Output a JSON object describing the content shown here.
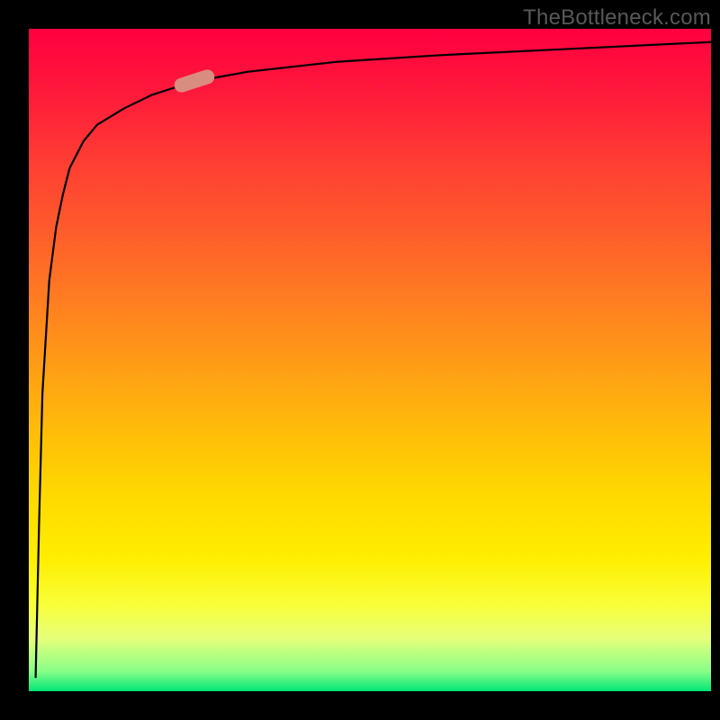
{
  "attribution": "TheBottleneck.com",
  "colors": {
    "frame": "#000000",
    "gradient_top": "#ff0040",
    "gradient_mid": "#ffd800",
    "gradient_bottom": "#00e676",
    "curve": "#000000",
    "marker": "#d98c80",
    "attribution_text": "#585858"
  },
  "chart_data": {
    "type": "line",
    "title": "",
    "xlabel": "",
    "ylabel": "",
    "xlim": [
      0,
      100
    ],
    "ylim": [
      0,
      100
    ],
    "series": [
      {
        "name": "curve",
        "x": [
          1.0,
          1.5,
          2,
          3,
          4,
          5,
          6,
          8,
          10,
          14,
          18,
          24,
          32,
          45,
          60,
          80,
          100
        ],
        "values": [
          2,
          25,
          45,
          62,
          70,
          75,
          79,
          83,
          85.5,
          88,
          90,
          92,
          93.5,
          95,
          96,
          97,
          98
        ]
      }
    ],
    "marker": {
      "x": 24,
      "y": 91
    },
    "legend": [],
    "grid": false
  }
}
